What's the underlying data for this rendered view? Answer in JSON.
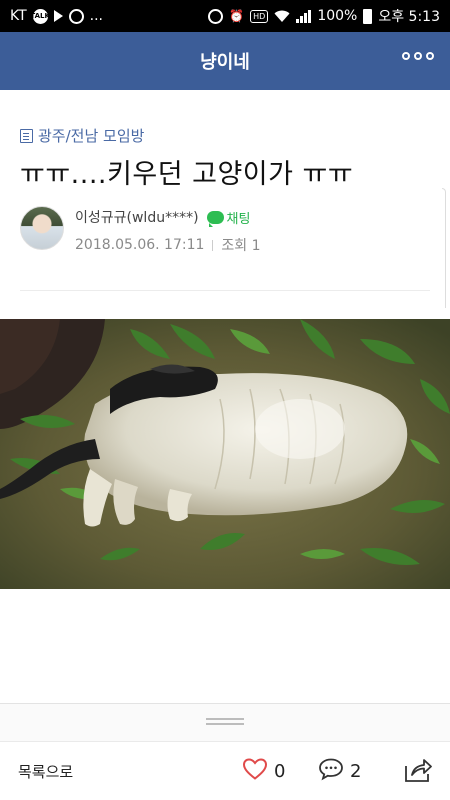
{
  "status_bar": {
    "carrier": "KT",
    "ellipsis": "...",
    "hd": "HD",
    "talk_badge": "TALK",
    "battery": "100%",
    "time": "오후 5:13"
  },
  "header": {
    "title": "냥이네",
    "more_icon": "more-horizontal-icon"
  },
  "article": {
    "board": "광주/전남 모임방",
    "title": "ㅠㅠ....키우던 고양이가 ㅠㅠ",
    "author": "이성규규(wldu****)",
    "chat_label": "채팅",
    "date": "2018.05.06. 17:11",
    "views": "조회 1"
  },
  "actions": {
    "list_label": "목록으로",
    "like_count": "0",
    "comment_count": "2"
  },
  "colors": {
    "header_bg": "#3c5d98",
    "board_link": "#4a6aa5",
    "chat_green": "#23b24b",
    "like_red": "#e04a4a"
  }
}
